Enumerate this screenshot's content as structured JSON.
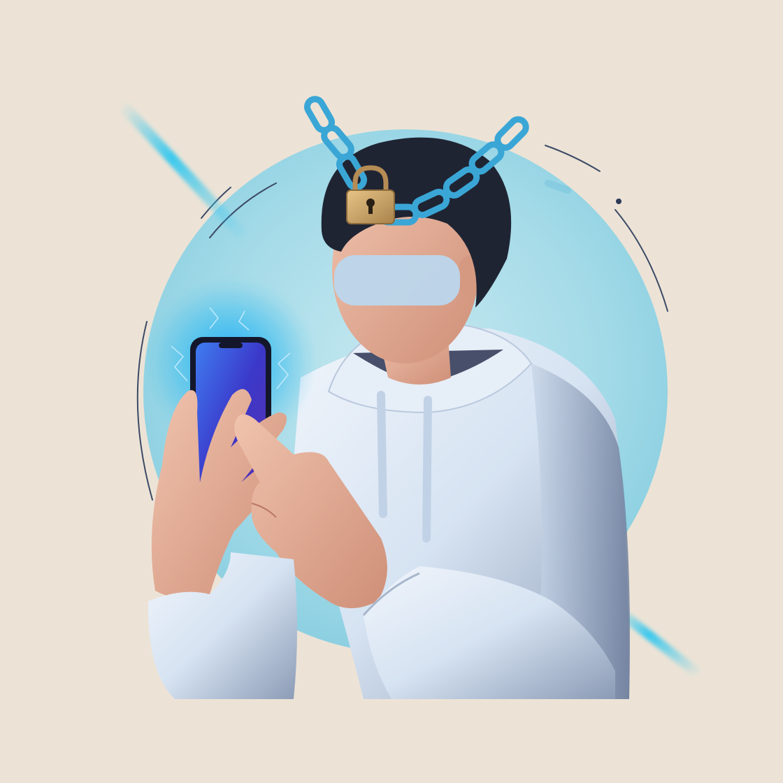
{
  "illustration": {
    "subject": "person-in-hoodie-holding-smartphone",
    "icons": [
      "chain-icon",
      "padlock-icon",
      "smartphone-icon",
      "lightning-icon"
    ],
    "colors": {
      "background": "#ece3d6",
      "accent_circle": "#8fd0e0",
      "chain": "#3aa6d6",
      "padlock": "#c9a268",
      "hoodie": "#d9e6f4",
      "hoodie_shadow": "#8c9bb6",
      "hair": "#1f2433",
      "skin": "#e0a88e",
      "face_band": "#bcd6ec",
      "phone_screen": "#3b38c9",
      "glow": "#29b8f0"
    }
  }
}
